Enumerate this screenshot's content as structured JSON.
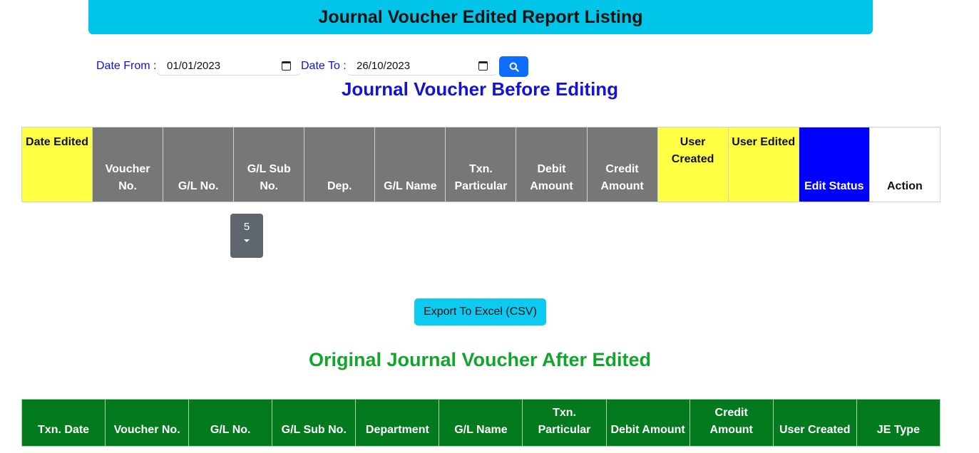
{
  "header": {
    "title": "Journal Voucher Edited Report Listing"
  },
  "filter": {
    "date_from_label": "Date From :",
    "date_from_value": "01/01/2023",
    "date_to_label": "Date To :",
    "date_to_value": "26/10/2023",
    "search_icon": "search-icon"
  },
  "before_section": {
    "heading": "Journal Voucher Before Editing",
    "columns": [
      "Date Edited",
      "Voucher No.",
      "G/L No.",
      "G/L Sub No.",
      "Dep.",
      "G/L Name",
      "Txn. Particular",
      "Debit Amount",
      "Credit Amount",
      "User Created",
      "User Edited",
      "Edit Status",
      "Action"
    ],
    "page_size": "5"
  },
  "export_label": "Export To Excel (CSV)",
  "after_section": {
    "heading": "Original Journal Voucher After Edited",
    "columns": [
      "Txn. Date",
      "Voucher No.",
      "G/L No.",
      "G/L Sub No.",
      "Department",
      "G/L Name",
      "Txn. Particular",
      "Debit Amount",
      "Credit Amount",
      "User Created",
      "JE Type"
    ]
  },
  "colors": {
    "title_bg": "#00c4e8",
    "before_heading": "#1313d6",
    "after_heading": "#12a52b",
    "header_gray": "#777777",
    "header_yellow": "#ffff44",
    "header_blue": "#0000ff",
    "after_header_green": "#047a1f"
  }
}
